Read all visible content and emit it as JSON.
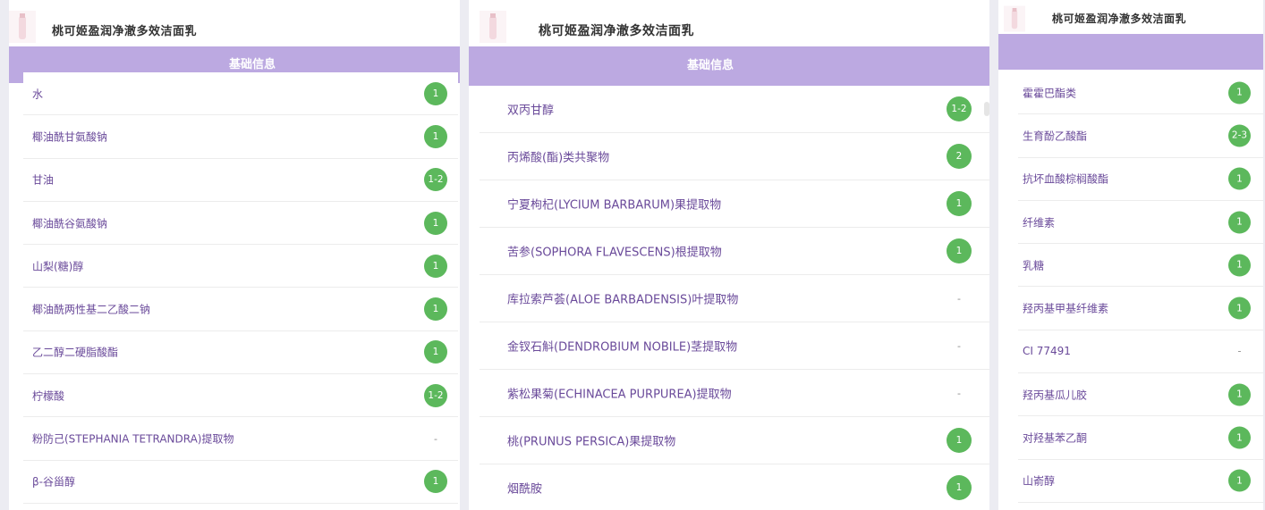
{
  "product_title": "桃可姬盈润净澈多效洁面乳",
  "section_label": "基础信息",
  "colors": {
    "bar": "#bca9e1",
    "badge": "#5cb85c",
    "text": "#6a4a9a"
  },
  "panel1": {
    "ingredients": [
      {
        "name": "水",
        "score": "1"
      },
      {
        "name": "椰油酰甘氨酸钠",
        "score": "1"
      },
      {
        "name": "甘油",
        "score": "1-2"
      },
      {
        "name": "椰油酰谷氨酸钠",
        "score": "1"
      },
      {
        "name": "山梨(糖)醇",
        "score": "1"
      },
      {
        "name": "椰油酰两性基二乙酸二钠",
        "score": "1"
      },
      {
        "name": "乙二醇二硬脂酸酯",
        "score": "1"
      },
      {
        "name": "柠檬酸",
        "score": "1-2"
      },
      {
        "name": "粉防己(STEPHANIA TETRANDRA)提取物",
        "score": "-"
      },
      {
        "name": "β-谷甾醇",
        "score": "1"
      }
    ]
  },
  "panel2": {
    "ingredients": [
      {
        "name": "双丙甘醇",
        "score": "1-2"
      },
      {
        "name": "丙烯酸(酯)类共聚物",
        "score": "2"
      },
      {
        "name": "宁夏枸杞(LYCIUM BARBARUM)果提取物",
        "score": "1"
      },
      {
        "name": "苦参(SOPHORA FLAVESCENS)根提取物",
        "score": "1"
      },
      {
        "name": "库拉索芦荟(ALOE BARBADENSIS)叶提取物",
        "score": "-"
      },
      {
        "name": "金钗石斛(DENDROBIUM NOBILE)茎提取物",
        "score": "-"
      },
      {
        "name": "紫松果菊(ECHINACEA PURPUREA)提取物",
        "score": "-"
      },
      {
        "name": "桃(PRUNUS PERSICA)果提取物",
        "score": "1"
      },
      {
        "name": "烟酰胺",
        "score": "1"
      }
    ]
  },
  "panel3": {
    "ingredients": [
      {
        "name": "霍霍巴酯类",
        "score": "1"
      },
      {
        "name": "生育酚乙酸酯",
        "score": "2-3"
      },
      {
        "name": "抗坏血酸棕榈酸酯",
        "score": "1"
      },
      {
        "name": "纤维素",
        "score": "1"
      },
      {
        "name": "乳糖",
        "score": "1"
      },
      {
        "name": "羟丙基甲基纤维素",
        "score": "1"
      },
      {
        "name": "CI 77491",
        "score": "-"
      },
      {
        "name": "羟丙基瓜儿胶",
        "score": "1"
      },
      {
        "name": "对羟基苯乙酮",
        "score": "1"
      },
      {
        "name": "山嵛醇",
        "score": "1"
      }
    ]
  }
}
